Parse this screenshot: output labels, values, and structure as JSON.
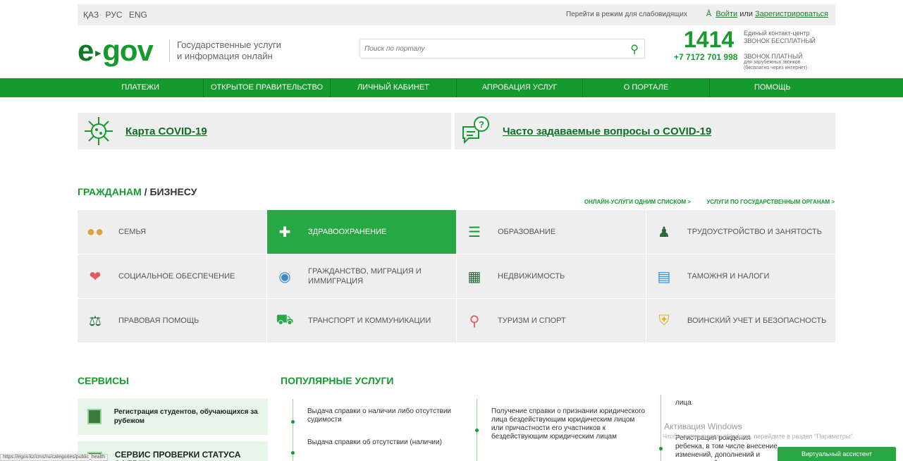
{
  "topbar": {
    "langs": [
      "ҚАЗ",
      "РУС",
      "ENG"
    ],
    "low_vision": "Перейти в режим для слабовидящих",
    "login": "Войти",
    "or": "или",
    "register": "Зарегистрироваться"
  },
  "header": {
    "logo_e": "e",
    "logo_gov": "gov",
    "tagline_1": "Государственные услуги",
    "tagline_2": "и информация онлайн",
    "search_placeholder": "Поиск по порталу",
    "contact_number": "1414",
    "contact_t1": "Единый контакт-центр",
    "contact_t2": "ЗВОНОК БЕСПЛАТНЫЙ",
    "phone": "+7 7172 701 998",
    "phone_t1": "ЗВОНОК ПЛАТНЫЙ",
    "phone_t2": "для зарубежных звонков",
    "phone_t3": "(бесплатно через интернет)"
  },
  "nav": [
    "ПЛАТЕЖИ",
    "ОТКРЫТОЕ ПРАВИТЕЛЬСТВО",
    "ЛИЧНЫЙ КАБИНЕТ",
    "АПРОБАЦИЯ УСЛУГ",
    "О ПОРТАЛЕ",
    "ПОМОЩЬ"
  ],
  "covid": {
    "map": "Карта COVID-19",
    "faq": "Часто задаваемые вопросы о COVID-19"
  },
  "section": {
    "title_a": "ГРАЖДАНАМ",
    "title_sep": " / ",
    "title_b": "БИЗНЕСУ",
    "link_online": "ОНЛАЙН-УСЛУГИ ОДНИМ СПИСКОМ >",
    "link_agencies": "УСЛУГИ ПО ГОСУДАРСТВЕННЫМ ОРГАНАМ >"
  },
  "categories": [
    {
      "label": "Семья",
      "icon": "family-icon"
    },
    {
      "label": "Здравоохранение",
      "icon": "health-icon"
    },
    {
      "label": "Образование",
      "icon": "books-icon"
    },
    {
      "label": "Трудоустройство и занятость",
      "icon": "worker-icon"
    },
    {
      "label": "Социальное обеспечение",
      "icon": "heart-hand-icon"
    },
    {
      "label": "Гражданство, миграция и иммиграция",
      "icon": "globe-people-icon"
    },
    {
      "label": "Недвижимость",
      "icon": "building-icon"
    },
    {
      "label": "Таможня и налоги",
      "icon": "tax-document-icon"
    },
    {
      "label": "Правовая помощь",
      "icon": "scales-icon"
    },
    {
      "label": "Транспорт и коммуникации",
      "icon": "truck-icon"
    },
    {
      "label": "Туризм и спорт",
      "icon": "map-pin-icon"
    },
    {
      "label": "Воинский учет и безопасность",
      "icon": "shield-icon"
    }
  ],
  "services": {
    "title": "СЕРВИСЫ",
    "items": [
      "Регистрация студентов, обучающихся за рубежом",
      "СЕРВИС ПРОВЕРКИ СТАТУСА ЗАЯВКИ"
    ]
  },
  "popular": {
    "title": "ПОПУЛЯРНЫЕ УСЛУГИ",
    "col1": [
      "Выдача справки о наличии либо отсутствии судимости",
      "Выдача справки об отсутствии (наличии)"
    ],
    "col2": [
      "Получение справки о признании юридического лица бездействующим юридическим лицом или причастности его участников к бездействующим юридическим лицам"
    ],
    "col3_top": "лица",
    "col3": [
      "Регистрация рождения ребенка, в том числе внесение изменений, дополнений и исправлений в записи ак"
    ]
  },
  "overlay": {
    "win_title": "Активация Windows",
    "win_sub": "Чтобы активировать Windows, перейдите в раздел \"Параметры\".",
    "status_url": "https://egov.kz/cms/ru/categories/public_health",
    "assistant": "Виртуальный ассистент"
  },
  "colors": {
    "brand": "#159a2e",
    "nav": "#159a2e",
    "active": "#28a745"
  }
}
